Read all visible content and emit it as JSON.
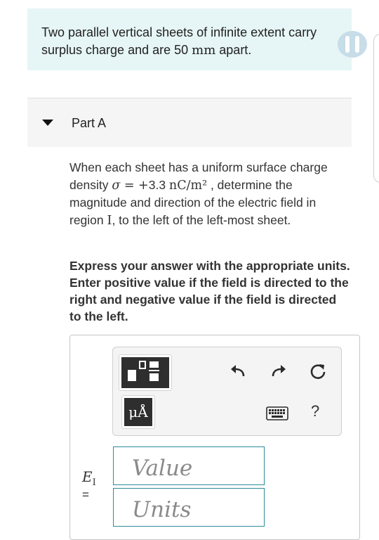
{
  "intro": {
    "text_before": "Two parallel vertical sheets of infinite extent carry surplus charge and are 50 ",
    "unit": "mm",
    "text_after": " apart."
  },
  "part": {
    "title": "Part A"
  },
  "question": {
    "t1": "When each sheet has a uniform surface charge density ",
    "sigma": "σ",
    "eq": " = +",
    "value": "3.3",
    "unit": "nC/m²",
    "t2": " , determine the magnitude and direction of the electric field in region ",
    "region": "I",
    "t3": ", to the left of the left-most sheet."
  },
  "instructions": "Express your answer with the appropriate units. Enter positive value if the field is directed to the right and negative value if the field is directed to the left.",
  "toolbar": {
    "units_label": "μÅ",
    "help_label": "?",
    "icons": [
      "templates-icon",
      "units-icon",
      "undo-icon",
      "redo-icon",
      "reset-icon",
      "keyboard-icon",
      "help-icon"
    ]
  },
  "answer": {
    "variable": "E",
    "variable_sub": "I",
    "equals": "=",
    "value_placeholder": "Value",
    "units_placeholder": "Units"
  },
  "colors": {
    "intro_bg": "#e6f5f6",
    "part_header_bg": "#f5f5f5",
    "input_border": "#2b8c9c",
    "toolbar_dark": "#2e2e2e"
  }
}
